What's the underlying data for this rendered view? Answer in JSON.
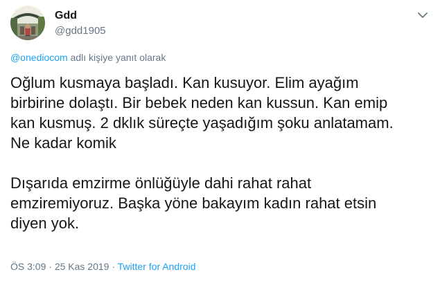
{
  "tweet": {
    "author": {
      "display_name": "Gdd",
      "handle": "@gdd1905"
    },
    "reply_to": {
      "mention": "@onediocom",
      "suffix": " adlı kişiye yanıt olarak"
    },
    "paragraphs": [
      "Oğlum kusmaya başladı. Kan kusuyor. Elim ayağım\nbirbirine dolaştı. Bir bebek neden kan kussun. Kan emip\nkan kusmuş. 2 dklık süreçte yaşadığım şoku anlatamam.\nNe kadar komik",
      "Dışarıda emzirme önlüğüyle dahi rahat rahat\nemziremiyoruz. Başka yöne bakayım kadın rahat etsin\ndiyen yok."
    ],
    "meta": {
      "time": "ÖS 3:09",
      "separator": " · ",
      "date": "25 Kas 2019",
      "source": "Twitter for Android"
    }
  },
  "icons": {
    "menu": "chevron-down-icon",
    "avatar": "avatar"
  },
  "colors": {
    "text": "#14171a",
    "secondary": "#657786",
    "link": "#1da1f2"
  }
}
